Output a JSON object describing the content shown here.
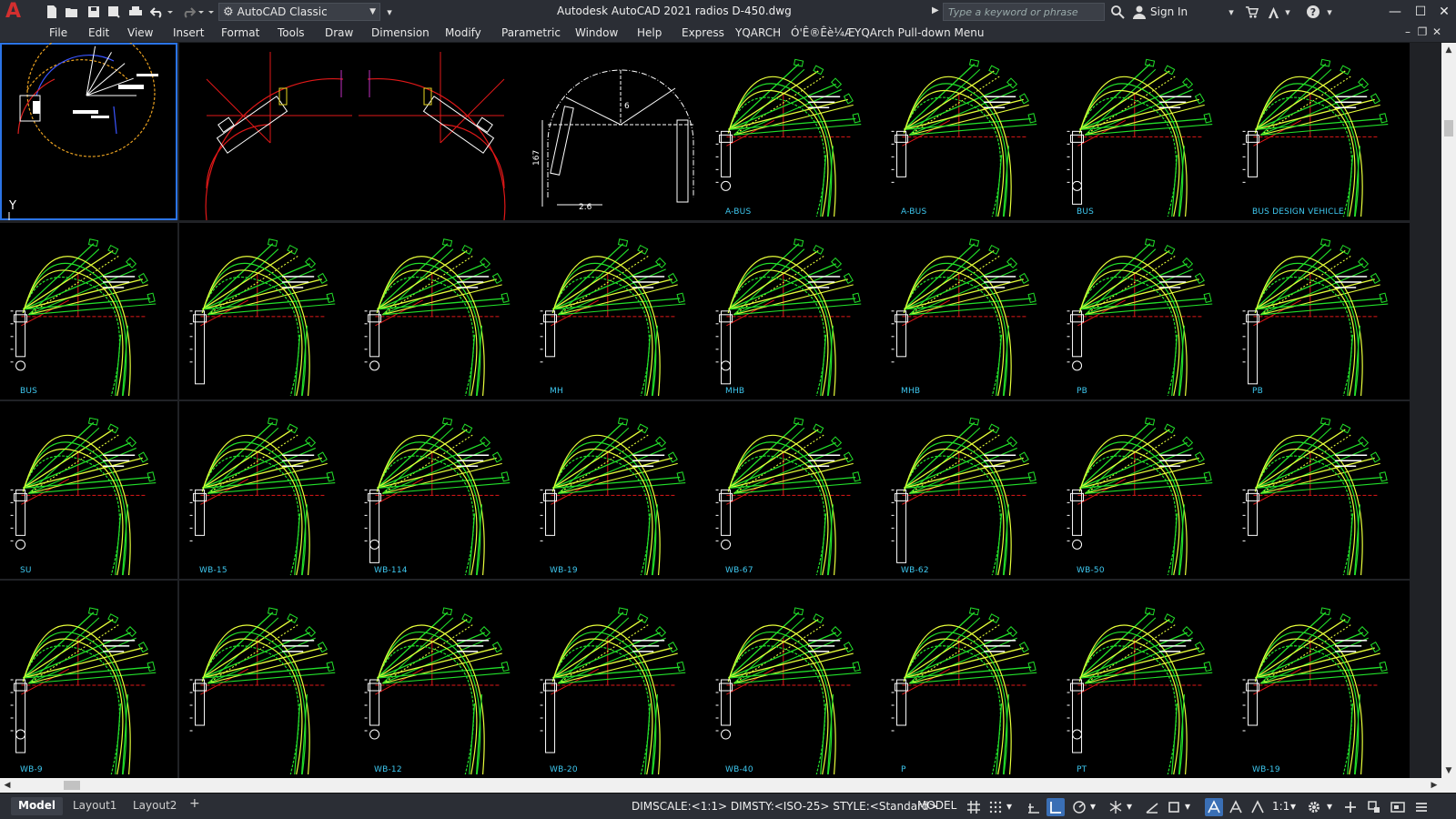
{
  "app": {
    "logo_letter": "A",
    "title": "Autodesk AutoCAD 2021    radios D-450.dwg",
    "workspace": "AutoCAD Classic",
    "search_placeholder": "Type a keyword or phrase",
    "sign_in": "Sign In"
  },
  "menu": {
    "items": [
      "File",
      "Edit",
      "View",
      "Insert",
      "Format",
      "Tools",
      "Draw",
      "Dimension",
      "Modify",
      "Parametric",
      "Window",
      "Help",
      "Express",
      "YQARCH",
      "Ó'Ê®Êè¼Æ",
      "YQArch Pull-down Menu"
    ]
  },
  "drawing": {
    "detail_dims": [
      "167",
      "2.6",
      "6"
    ],
    "tile_labels": [
      "",
      "",
      "",
      "",
      "A-BUS",
      "A-BUS",
      "BUS",
      "BUS DESIGN VEHICLE",
      "BUS",
      "",
      "",
      "MH",
      "MHB",
      "MHB",
      "PB",
      "PB",
      "SU",
      "WB-15",
      "WB-114",
      "WB-19",
      "WB-67",
      "WB-62",
      "WB-50",
      "",
      "WB-9",
      "",
      "WB-12",
      "WB-20",
      "WB-40",
      "P",
      "PT",
      "WB-19"
    ]
  },
  "tabs": [
    "Model",
    "Layout1",
    "Layout2"
  ],
  "status": {
    "info": "DIMSCALE:<1:1> DIMSTY:<ISO-25> STYLE:<Standard>",
    "model": "MODEL",
    "scale": "1:1"
  },
  "colors": {
    "chrome": "#2b2e35",
    "active_border": "#2b74e6",
    "curve_green": "#22e02a",
    "curve_yellow": "#e8ff3a",
    "guide_red": "#e01818",
    "label_cyan": "#3ec8f0"
  }
}
